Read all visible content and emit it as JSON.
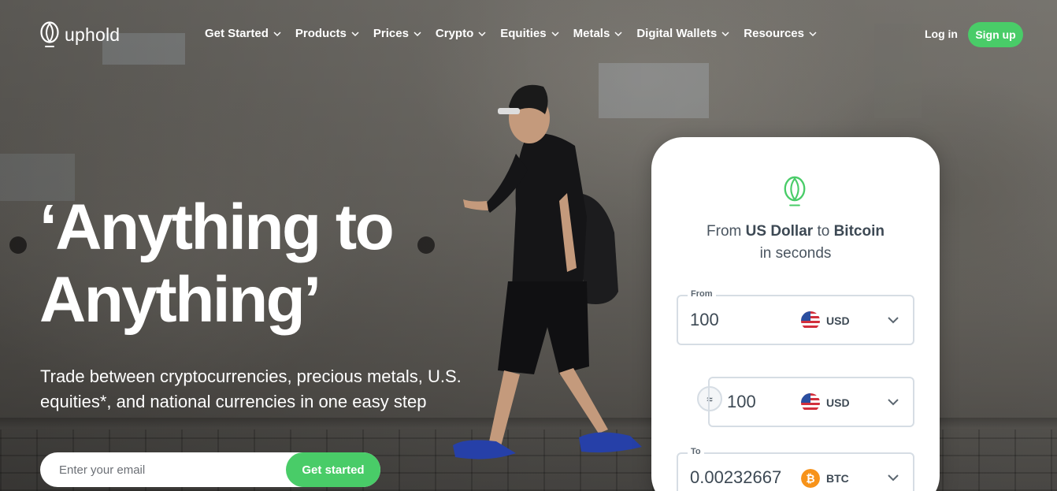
{
  "brand": {
    "name": "uphold",
    "accent": "#49cc68"
  },
  "nav": {
    "items": [
      {
        "label": "Get Started"
      },
      {
        "label": "Products"
      },
      {
        "label": "Prices"
      },
      {
        "label": "Crypto"
      },
      {
        "label": "Equities"
      },
      {
        "label": "Metals"
      },
      {
        "label": "Digital Wallets"
      },
      {
        "label": "Resources"
      }
    ],
    "login_label": "Log in",
    "signup_label": "Sign up"
  },
  "hero": {
    "headline_line1": "‘Anything to",
    "headline_line2": "Anything’",
    "subheadline": "Trade between cryptocurrencies, precious metals, U.S. equities*, and national currencies in one easy step",
    "email_placeholder": "Enter your email",
    "cta_label": "Get started"
  },
  "converter": {
    "title_from_prefix": "From ",
    "title_from_currency": "US Dollar",
    "title_to_word": " to ",
    "title_to_currency": "Bitcoin",
    "title_suffix": "in seconds",
    "from": {
      "label": "From",
      "value": "100",
      "currency": "USD",
      "icon": "us-flag-icon"
    },
    "middle": {
      "value": "100",
      "currency": "USD",
      "icon": "us-flag-icon"
    },
    "swap_icon": "approx-equal-icon",
    "to": {
      "label": "To",
      "value": "0.00232667",
      "currency": "BTC",
      "icon": "bitcoin-icon"
    },
    "btc_color": "#f7931a"
  }
}
